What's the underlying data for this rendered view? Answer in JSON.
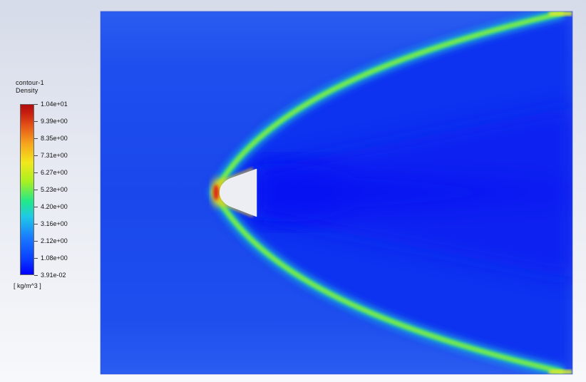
{
  "legend": {
    "title_line1": "contour-1",
    "title_line2": "Density",
    "units": "[ kg/m^3 ]",
    "ticks": [
      "1.04e+01",
      "9.39e+00",
      "8.35e+00",
      "7.31e+00",
      "6.27e+00",
      "5.23e+00",
      "4.20e+00",
      "3.16e+00",
      "2.12e+00",
      "1.08e+00",
      "3.91e-02"
    ]
  },
  "colors": {
    "freestream": "#1e52ee",
    "wake": "#0515f0",
    "shock_edge": "#1fd8ac",
    "shock_core": "#8ef028",
    "stagnation": "#d82a12",
    "body": "#eceef4"
  }
}
